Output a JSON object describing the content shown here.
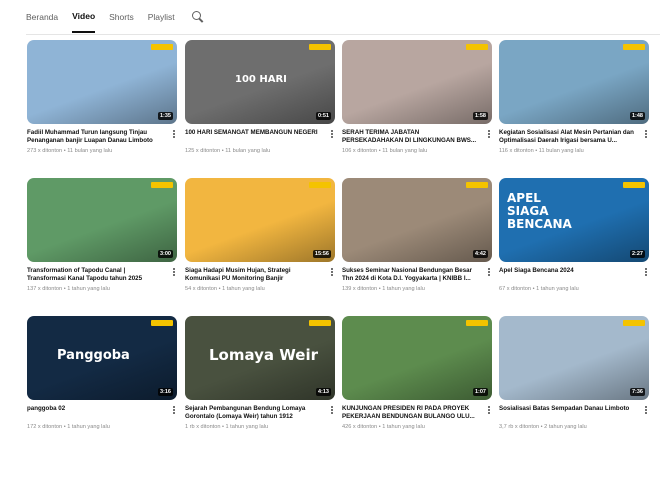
{
  "tabs": [
    {
      "label": "Beranda",
      "active": false
    },
    {
      "label": "Video",
      "active": true
    },
    {
      "label": "Shorts",
      "active": false
    },
    {
      "label": "Playlist",
      "active": false
    }
  ],
  "videos": [
    {
      "title": "Fadiil Muhammad Turun langsung Tinjau Penanganan banjir Luapan Danau Limboto",
      "meta": "273 x ditonton • 11 bulan yang lalu",
      "duration": "1:35",
      "thumb_color": "#8fb4d6",
      "overlay": ""
    },
    {
      "title": "100 HARI SEMANGAT MEMBANGUN NEGERI",
      "meta": "125 x ditonton • 11 bulan yang lalu",
      "duration": "0:51",
      "thumb_color": "#6e6e6e",
      "overlay": "100 HARI"
    },
    {
      "title": "SERAH TERIMA JABATAN PERSEKADAHAKAN DI LINGKUNGAN BWS...",
      "meta": "106 x ditonton • 11 bulan yang lalu",
      "duration": "1:58",
      "thumb_color": "#b8a6a0",
      "overlay": ""
    },
    {
      "title": "Kegiatan Sosialisasi Alat Mesin Pertanian dan Optimalisasi Daerah Irigasi bersama U...",
      "meta": "116 x ditonton • 11 bulan yang lalu",
      "duration": "1:48",
      "thumb_color": "#7aa6c4",
      "overlay": ""
    },
    {
      "title": "Transformation of Tapodu Canal | Transformasi Kanal Tapodu tahun 2025",
      "meta": "137 x ditonton • 1 tahun yang lalu",
      "duration": "3:00",
      "thumb_color": "#5f9a66",
      "overlay": ""
    },
    {
      "title": "Siaga Hadapi Musim Hujan, Strategi Komunikasi PU Monitoring Banjir",
      "meta": "54 x ditonton • 1 tahun yang lalu",
      "duration": "15:56",
      "thumb_color": "#f2b640",
      "overlay": ""
    },
    {
      "title": "Sukses Seminar Nasional Bendungan Besar Thn 2024 di Kota D.I. Yogyakarta | KNIBB I...",
      "meta": "139 x ditonton • 1 tahun yang lalu",
      "duration": "4:42",
      "thumb_color": "#9c8a78",
      "overlay": ""
    },
    {
      "title": "Apel Siaga Bencana 2024",
      "meta": "67 x ditonton • 1 tahun yang lalu",
      "duration": "2:27",
      "thumb_color": "#1f6fb0",
      "overlay": "APEL SIAGA BENCANA"
    },
    {
      "title": "panggoba 02",
      "meta": "172 x ditonton • 1 tahun yang lalu",
      "duration": "3:16",
      "thumb_color": "#132a44",
      "overlay": "Panggoba"
    },
    {
      "title": "Sejarah Pembangunan Bendung Lomaya Gorontalo (Lomaya Weir) tahun 1912",
      "meta": "1 rb x ditonton • 1 tahun yang lalu",
      "duration": "4:13",
      "thumb_color": "#49513f",
      "overlay": "Lomaya Weir"
    },
    {
      "title": "KUNJUNGAN PRESIDEN RI PADA PROYEK PEKERJAAN BENDUNGAN BULANGO ULU...",
      "meta": "426 x ditonton • 1 tahun yang lalu",
      "duration": "1:07",
      "thumb_color": "#5d8c4e",
      "overlay": ""
    },
    {
      "title": "Sosialisasi Batas Sempadan Danau Limboto",
      "meta": "3,7 rb x ditonton • 2 tahun yang lalu",
      "duration": "7:36",
      "thumb_color": "#a4b9cc",
      "overlay": ""
    }
  ]
}
